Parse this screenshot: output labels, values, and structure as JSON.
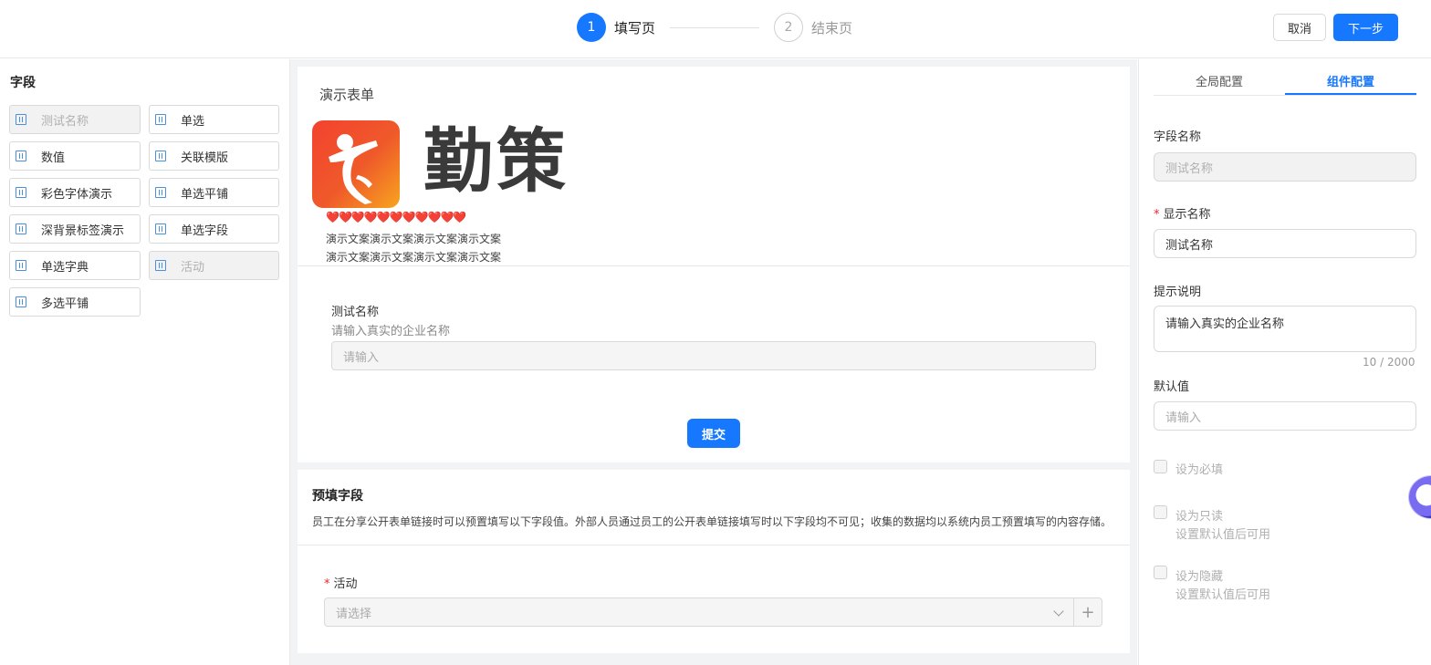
{
  "header": {
    "steps": [
      {
        "number": "1",
        "label": "填写页"
      },
      {
        "number": "2",
        "label": "结束页"
      }
    ],
    "cancel_label": "取消",
    "next_label": "下一步"
  },
  "left_panel": {
    "title": "字段",
    "fields": [
      {
        "label": "测试名称",
        "disabled": true
      },
      {
        "label": "单选",
        "disabled": false
      },
      {
        "label": "数值",
        "disabled": false
      },
      {
        "label": "关联模版",
        "disabled": false
      },
      {
        "label": "彩色字体演示",
        "disabled": false
      },
      {
        "label": "单选平铺",
        "disabled": false
      },
      {
        "label": "深背景标签演示",
        "disabled": false
      },
      {
        "label": "单选字段",
        "disabled": false
      },
      {
        "label": "单选字典",
        "disabled": false
      },
      {
        "label": "活动",
        "disabled": true
      },
      {
        "label": "多选平铺",
        "disabled": false
      }
    ]
  },
  "form": {
    "title": "演示表单",
    "logo_text": "勤策",
    "hearts": "❤️❤️❤️❤️❤️❤️❤️❤️❤️❤️❤️",
    "demo_lines": [
      "演示文案演示文案演示文案演示文案",
      "演示文案演示文案演示文案演示文案"
    ],
    "question_label": "测试名称",
    "question_hint": "请输入真实的企业名称",
    "question_placeholder": "请输入",
    "submit_label": "提交"
  },
  "prefill": {
    "title": "预填字段",
    "description": "员工在分享公开表单链接时可以预置填写以下字段值。外部人员通过员工的公开表单链接填写时以下字段均不可见；收集的数据均以系统内员工预置填写的内容存储。",
    "activity_required": "*",
    "activity_label": "活动",
    "activity_placeholder": "请选择",
    "add_symbol": "+"
  },
  "right_panel": {
    "tabs": [
      {
        "label": "全局配置",
        "active": false
      },
      {
        "label": "组件配置",
        "active": true
      }
    ],
    "field_name_label": "字段名称",
    "field_name_value": "测试名称",
    "display_name_required": "*",
    "display_name_label": "显示名称",
    "display_name_value": "测试名称",
    "hint_label": "提示说明",
    "hint_value": "请输入真实的企业名称",
    "hint_count": "10 / 2000",
    "default_label": "默认值",
    "default_placeholder": "请输入",
    "checkboxes": [
      {
        "label": "设为必填",
        "sub": ""
      },
      {
        "label": "设为只读",
        "sub": "设置默认值后可用"
      },
      {
        "label": "设为隐藏",
        "sub": "设置默认值后可用"
      }
    ]
  },
  "colors": {
    "accent": "#1677ff",
    "required": "#f5222d",
    "page_bg": "#f2f3f5"
  }
}
